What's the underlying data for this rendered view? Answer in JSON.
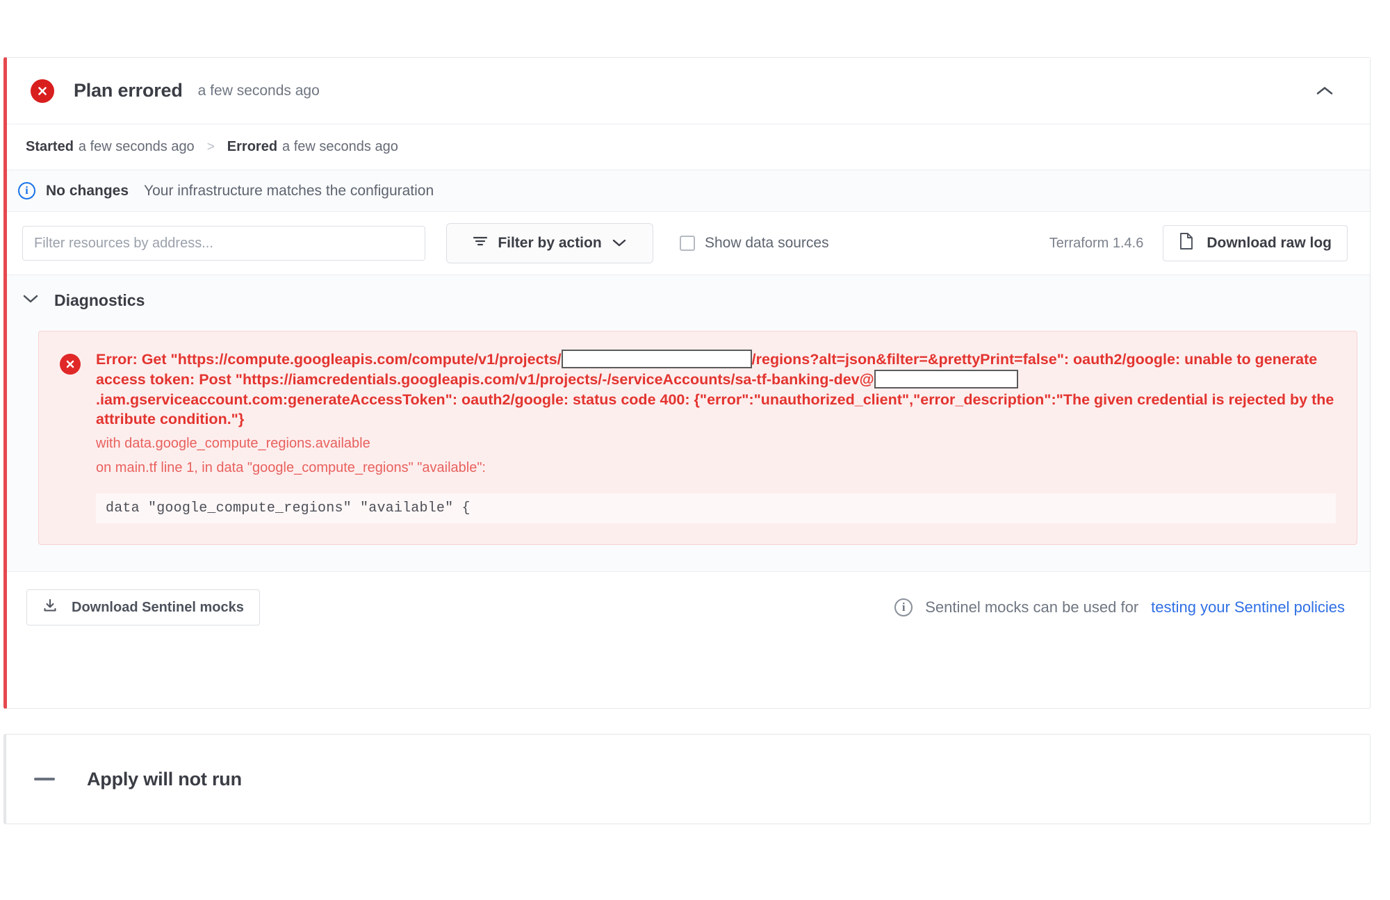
{
  "plan_panel": {
    "status_icon": "error-circle-x-icon",
    "title": "Plan errored",
    "timestamp": "a few seconds ago",
    "collapse_icon": "chevron-up-icon",
    "accent_color": "#e5484d",
    "timeline": {
      "started_label": "Started",
      "started_value": "a few seconds ago",
      "separator": ">",
      "errored_label": "Errored",
      "errored_value": "a few seconds ago"
    },
    "no_changes": {
      "icon": "info-circle-icon",
      "title": "No changes",
      "description": "Your infrastructure matches the configuration"
    },
    "toolbar": {
      "filter_placeholder": "Filter resources by address...",
      "filter_value": "",
      "filter_action_icon": "filter-icon",
      "filter_action_label": "Filter by action",
      "filter_action_chevron": "chevron-down-icon",
      "show_data_sources_label": "Show data sources",
      "show_data_sources_checked": false,
      "terraform_version": "Terraform 1.4.6",
      "download_log_icon": "file-icon",
      "download_log_label": "Download raw log"
    },
    "diagnostics": {
      "chevron": "chevron-down-icon",
      "title": "Diagnostics",
      "error": {
        "icon": "error-circle-x-icon",
        "color": "#e3342f",
        "message_part_1": "Error: Get \"https://compute.googleapis.com/compute/v1/projects/",
        "redaction_1": "redacted-project-id",
        "message_part_2": "/regions?alt=json&filter=&prettyPrint=false\": oauth2/google: unable to generate access token: Post \"https://iamcredentials.googleapis.com/v1/projects/-/serviceAccounts/sa-tf-banking-dev@",
        "redaction_2": "redacted-project-id",
        "message_part_3": ".iam.gserviceaccount.com:generateAccessToken\": oauth2/google: status code 400: {\"error\":\"unauthorized_client\",\"error_description\":\"The given credential is rejected by the attribute condition.\"}",
        "sub_line_1": "with data.google_compute_regions.available",
        "sub_line_2": "on main.tf line 1, in data \"google_compute_regions\" \"available\":",
        "code_snippet": "data \"google_compute_regions\" \"available\" {"
      }
    },
    "footer": {
      "download_mocks_icon": "download-icon",
      "download_mocks_label": "Download Sentinel mocks",
      "note_icon": "info-circle-icon",
      "note_text": "Sentinel mocks can be used for",
      "note_link": "testing your Sentinel policies",
      "link_color": "#2f6fe4"
    }
  },
  "apply_panel": {
    "icon": "dash-icon",
    "title": "Apply will not run"
  }
}
